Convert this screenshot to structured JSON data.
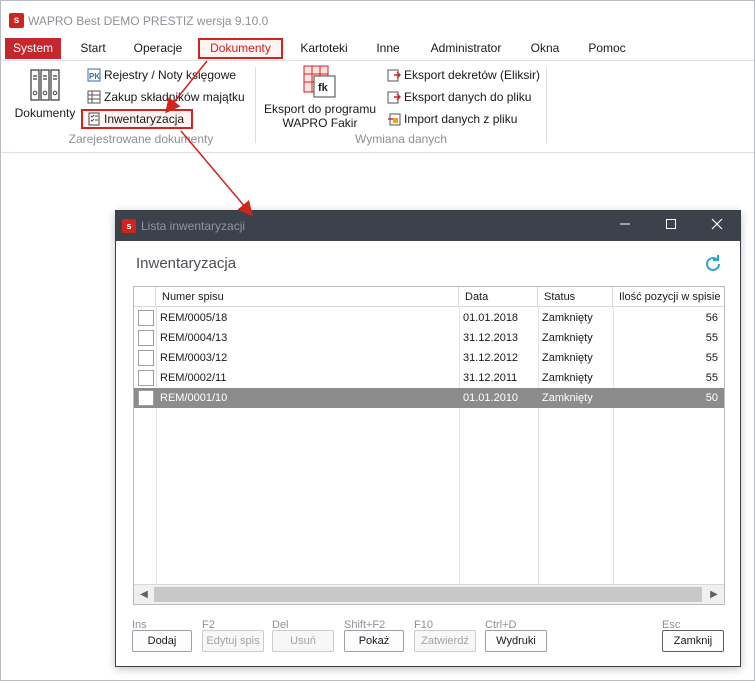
{
  "app": {
    "title": "WAPRO Best DEMO PRESTIZ wersja 9.10.0",
    "logo_text": "s"
  },
  "menu": {
    "system": "System",
    "items": [
      "Start",
      "Operacje",
      "Dokumenty",
      "Kartoteki",
      "Inne",
      "Administrator",
      "Okna",
      "Pomoc"
    ]
  },
  "ribbon": {
    "dokumenty_label": "Dokumenty",
    "rejestry_label": "Rejestry / Noty księgowe",
    "zakup_label": "Zakup składników majątku",
    "inwentaryzacja_label": "Inwentaryzacja",
    "group1_label": "Zarejestrowane dokumenty",
    "eksport_fakir_line1": "Eksport do programu",
    "eksport_fakir_line2": "WAPRO Fakir",
    "fk_icon_text": "fk",
    "eksport_dekretow": "Eksport dekretów (Eliksir)",
    "eksport_danych": "Eksport danych do pliku",
    "import_danych": "Import danych z pliku",
    "group2_label": "Wymiana danych"
  },
  "dialog": {
    "title": "Lista inwentaryzacji",
    "heading": "Inwentaryzacja",
    "columns": [
      "Numer spisu",
      "Data",
      "Status",
      "Ilość pozycji w spisie"
    ],
    "rows": [
      {
        "numer": "REM/0005/18",
        "data": "01.01.2018",
        "status": "Zamknięty",
        "ilosc": "56"
      },
      {
        "numer": "REM/0004/13",
        "data": "31.12.2013",
        "status": "Zamknięty",
        "ilosc": "55"
      },
      {
        "numer": "REM/0003/12",
        "data": "31.12.2012",
        "status": "Zamknięty",
        "ilosc": "55"
      },
      {
        "numer": "REM/0002/11",
        "data": "31.12.2011",
        "status": "Zamknięty",
        "ilosc": "55"
      },
      {
        "numer": "REM/0001/10",
        "data": "01.01.2010",
        "status": "Zamknięty",
        "ilosc": "50"
      }
    ],
    "buttons": {
      "dodaj": {
        "key": "Ins",
        "label": "Dodaj"
      },
      "edytuj": {
        "key": "F2",
        "label": "Edytuj spis"
      },
      "usun": {
        "key": "Del",
        "label": "Usuń"
      },
      "pokaz": {
        "key": "Shift+F2",
        "label": "Pokaż"
      },
      "zatwierdz": {
        "key": "F10",
        "label": "Zatwierdź"
      },
      "wydruki": {
        "key": "Ctrl+D",
        "label": "Wydruki"
      },
      "zamknij": {
        "key": "Esc",
        "label": "Zamknij"
      }
    }
  },
  "colors": {
    "accent": "#d0241c",
    "dialog_titlebar": "#3c424b",
    "selected_row": "#8c8c8c"
  }
}
